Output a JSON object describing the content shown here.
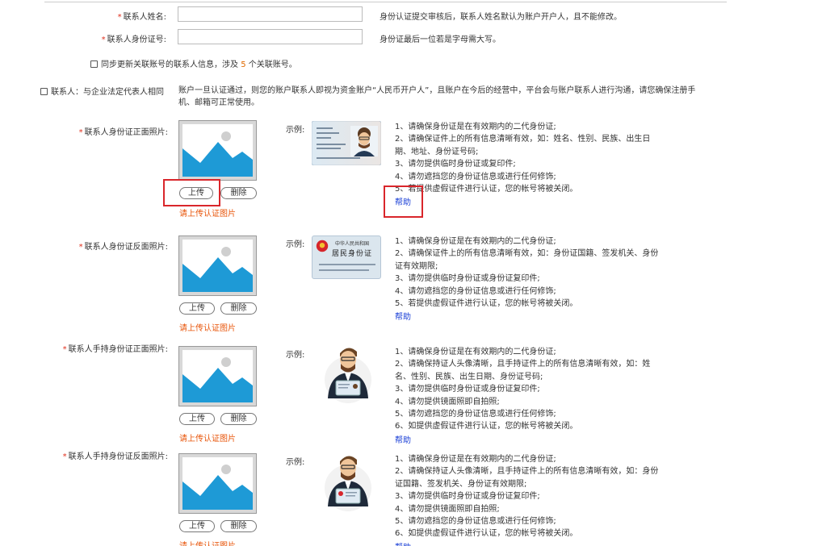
{
  "form": {
    "name_label": "联系人姓名:",
    "name_hint": "身份认证提交审核后，联系人姓名默认为账户开户人，且不能修改。",
    "id_label": "联系人身份证号:",
    "id_hint": "身份证最后一位若是字母需大写。",
    "sync_prefix": "同步更新关联账号的联系人信息，涉及",
    "sync_count": "5",
    "sync_suffix": "个关联账号。",
    "same_label": "联系人：与企业法定代表人相同",
    "same_desc": "账户一旦认证通过，则您的账户联系人即视为资金账户“人民币开户人”，且账户在今后的经营中，平台会与账户联系人进行沟通，请您确保注册手机、邮箱可正常使用。"
  },
  "common": {
    "example_label": "示例:",
    "upload_button": "上传",
    "delete_button": "删除",
    "upload_error": "请上传认证图片",
    "help_link": "帮助"
  },
  "sections": [
    {
      "label": "联系人身份证正面照片:",
      "tips": [
        "1、请确保身份证是在有效期内的二代身份证;",
        "2、请确保证件上的所有信息清晰有效，如：姓名、性别、民族、出生日期、地址、身份证号码;",
        "3、请勿提供临时身份证或复印件;",
        "4、请勿遮挡您的身份证信息或进行任何修饰;",
        "5、若提供虚假证件进行认证，您的帐号将被关闭。"
      ]
    },
    {
      "label": "联系人身份证反面照片:",
      "card_title_small": "中华人民共和国",
      "card_title_big": "居民身份证",
      "tips": [
        "1、请确保身份证是在有效期内的二代身份证;",
        "2、请确保证件上的所有信息清晰有效，如：身份证国籍、签发机关、身份证有效期限;",
        "3、请勿提供临时身份证或身份证复印件;",
        "4、请勿遮挡您的身份证信息或进行任何修饰;",
        "5、若提供虚假证件进行认证，您的帐号将被关闭。"
      ]
    },
    {
      "label": "联系人手持身份证正面照片:",
      "tips": [
        "1、请确保身份证是在有效期内的二代身份证;",
        "2、请确保持证人头像清晰，且手持证件上的所有信息清晰有效，如：姓名、性别、民族、出生日期、身份证号码;",
        "3、请勿提供临时身份证或身份证复印件;",
        "4、请勿提供镜面照即自拍照;",
        "5、请勿遮挡您的身份证信息或进行任何修饰;",
        "6、如提供虚假证件进行认证，您的帐号将被关闭。"
      ]
    },
    {
      "label": "联系人手持身份证反面照片:",
      "tips": [
        "1、请确保身份证是在有效期内的二代身份证;",
        "2、请确保持证人头像清晰，且手持证件上的所有信息清晰有效，如：身份证国籍、签发机关、身份证有效期限;",
        "3、请勿提供临时身份证或身份证复印件;",
        "4、请勿提供镜面照即自拍照;",
        "5、请勿遮挡您的身份证信息或进行任何修饰;",
        "6、如提供虚假证件进行认证，您的帐号将被关闭。"
      ]
    }
  ],
  "colors": {
    "required": "#e0301e",
    "error": "#e8550a",
    "link": "#1a3fd6",
    "highlight_box": "#d9262b",
    "placeholder_blue": "#1e9ad6"
  }
}
